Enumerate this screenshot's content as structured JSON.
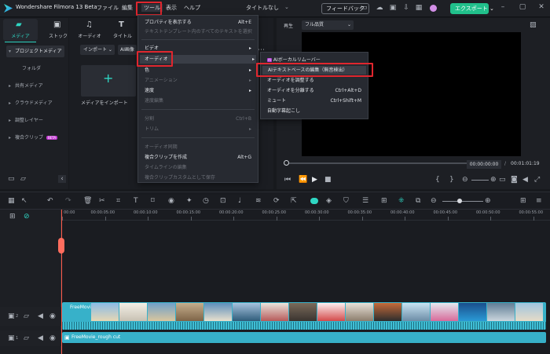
{
  "app": {
    "title": "Wondershare Filmora 13 Beta"
  },
  "menubar": {
    "items": [
      "ファイル",
      "編集",
      "ツール",
      "表示",
      "ヘルプ"
    ],
    "active": "ツール"
  },
  "titlebar": {
    "project_name": "タイトルなし",
    "feedback_label": "フィードバック",
    "export_label": "エクスポート"
  },
  "colors": {
    "accent": "#2fd6c3",
    "export_bg": "#21c08b",
    "highlight": "#e0262e",
    "menu_bg": "#272a31",
    "video_track": "#37b1c9"
  },
  "toolbar_tabs": [
    {
      "label": "メディア",
      "icon": "folder-icon",
      "active": true
    },
    {
      "label": "ストック",
      "icon": "stock-icon"
    },
    {
      "label": "オーディオ",
      "icon": "music-note-icon"
    },
    {
      "label": "タイトル",
      "icon": "title-t-icon"
    }
  ],
  "sidebar": {
    "items": [
      {
        "label": "プロジェクトメディア",
        "active": true
      },
      {
        "label": "フォルダ"
      },
      {
        "label": "共有メディア"
      },
      {
        "label": "クラウドメディア"
      },
      {
        "label": "調整レイヤー"
      },
      {
        "label": "複合クリップ",
        "badge": "BETA"
      }
    ]
  },
  "media": {
    "import_dropdown": "インポート",
    "ai_button": "AI画像",
    "import_tile_label": "メディアをインポート"
  },
  "tools_menu": {
    "items": [
      {
        "label": "プロパティを表示する",
        "shortcut": "Alt+E",
        "enabled": true
      },
      {
        "label": "テキストテンプレート内のすべてのテキストを選択",
        "enabled": false
      },
      {
        "label": "ビデオ",
        "enabled": true,
        "submenu": true
      },
      {
        "label": "オーディオ",
        "enabled": true,
        "submenu": true,
        "highlighted": true
      },
      {
        "label": "色",
        "enabled": true,
        "submenu": true
      },
      {
        "label": "アニメーション",
        "enabled": false,
        "submenu": true
      },
      {
        "label": "速度",
        "enabled": true,
        "submenu": true
      },
      {
        "label": "速度編集",
        "enabled": false
      },
      {
        "label": "分割",
        "shortcut": "Ctrl+B",
        "enabled": false
      },
      {
        "label": "トリム",
        "enabled": false,
        "submenu": true
      },
      {
        "label": "オーディオ同期",
        "enabled": false
      },
      {
        "label": "複合クリップを作成",
        "shortcut": "Alt+G",
        "enabled": true
      },
      {
        "label": "タイムラインの編集",
        "enabled": false
      },
      {
        "label": "複合クリップカスタムとして保存",
        "enabled": false
      }
    ]
  },
  "audio_submenu": {
    "items": [
      {
        "label": "AIボーカルリムーバー",
        "badge": "AI"
      },
      {
        "label": "AIテキストベースの編集（無音検出）",
        "highlighted": true
      },
      {
        "label": "オーディオを調整する"
      },
      {
        "label": "オーディオを分離する",
        "shortcut": "Ctrl+Alt+D"
      },
      {
        "label": "ミュート",
        "shortcut": "Ctrl+Shift+M"
      },
      {
        "label": "自動字幕起こし"
      }
    ]
  },
  "preview": {
    "play_label": "再生",
    "quality": "フル品質",
    "current_time": "00:00:00:00",
    "duration": "00:01:01:19"
  },
  "timeline": {
    "ticks": [
      "00:00",
      "00:00:05:00",
      "00:00:10:00",
      "00:00:15:00",
      "00:00:20:00",
      "00:00:25:00",
      "00:00:30:00",
      "00:00:35:00",
      "00:00:40:00",
      "00:00:45:00",
      "00:00:50:00",
      "00:00:55:00"
    ],
    "video_clip_label": "FreeMovie_rough cut",
    "audio_clip_label": "FreeMovie_rough cut",
    "track_video_num": "2",
    "track_audio_num": "1"
  }
}
